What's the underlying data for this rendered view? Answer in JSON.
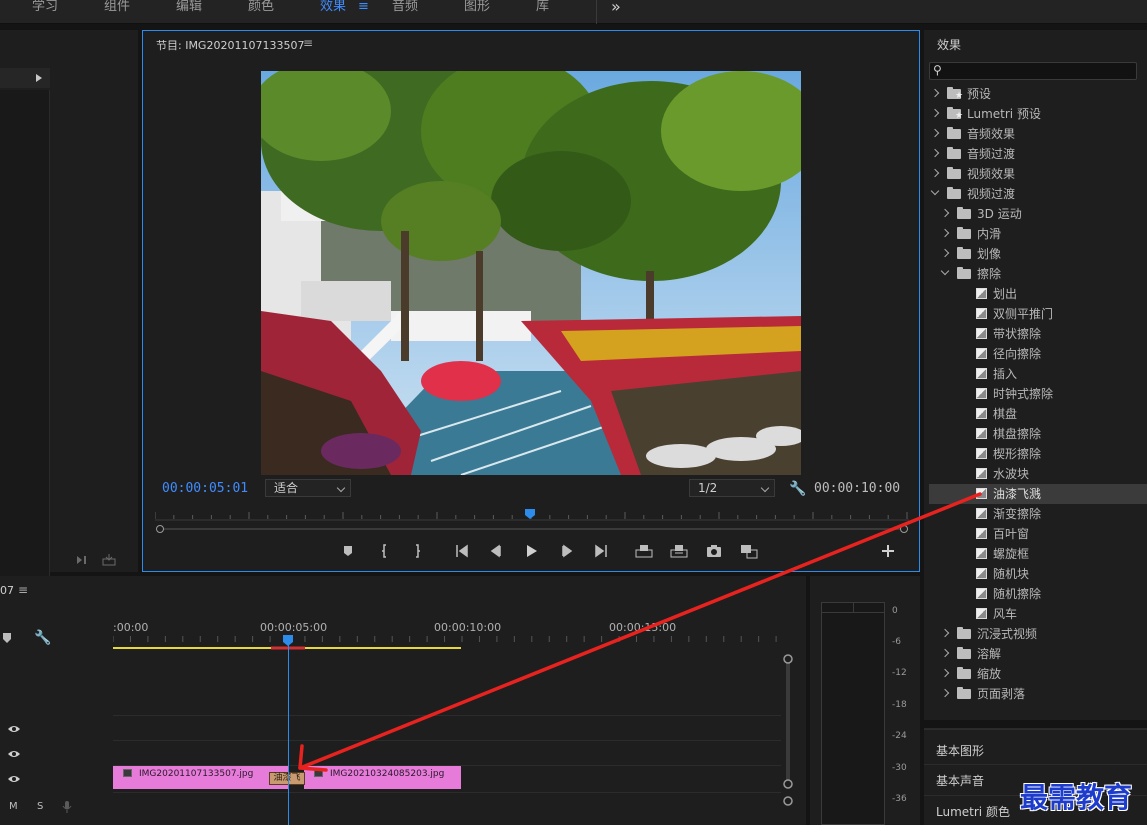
{
  "workspace": {
    "tabs": [
      {
        "label": "学习",
        "active": false
      },
      {
        "label": "组件",
        "active": false
      },
      {
        "label": "编辑",
        "active": false
      },
      {
        "label": "颜色",
        "active": false
      },
      {
        "label": "效果",
        "active": true
      },
      {
        "label": "音频",
        "active": false
      },
      {
        "label": "图形",
        "active": false
      },
      {
        "label": "库",
        "active": false
      }
    ],
    "menu_glyph": "≡",
    "more_glyph": "»"
  },
  "program": {
    "title": "节目: IMG20201107133507",
    "menu_glyph": "≡",
    "timecode_current": "00:00:05:01",
    "timecode_duration": "00:00:10:00",
    "fit_select": "适合",
    "resolution_select": "1/2",
    "accent_color": "#2d8ceb"
  },
  "effects": {
    "title": "效果",
    "search_placeholder": "",
    "tree": [
      {
        "label": "预设",
        "level": 0,
        "type": "preset-folder",
        "expanded": false
      },
      {
        "label": "Lumetri 预设",
        "level": 0,
        "type": "preset-folder",
        "expanded": false
      },
      {
        "label": "音频效果",
        "level": 0,
        "type": "folder",
        "expanded": false
      },
      {
        "label": "音频过渡",
        "level": 0,
        "type": "folder",
        "expanded": false
      },
      {
        "label": "视频效果",
        "level": 0,
        "type": "folder",
        "expanded": false
      },
      {
        "label": "视频过渡",
        "level": 0,
        "type": "folder",
        "expanded": true
      },
      {
        "label": "3D 运动",
        "level": 1,
        "type": "folder",
        "expanded": false
      },
      {
        "label": "内滑",
        "level": 1,
        "type": "folder",
        "expanded": false
      },
      {
        "label": "划像",
        "level": 1,
        "type": "folder",
        "expanded": false
      },
      {
        "label": "擦除",
        "level": 1,
        "type": "folder",
        "expanded": true
      },
      {
        "label": "划出",
        "level": 2,
        "type": "effect"
      },
      {
        "label": "双侧平推门",
        "level": 2,
        "type": "effect"
      },
      {
        "label": "带状擦除",
        "level": 2,
        "type": "effect"
      },
      {
        "label": "径向擦除",
        "level": 2,
        "type": "effect"
      },
      {
        "label": "插入",
        "level": 2,
        "type": "effect"
      },
      {
        "label": "时钟式擦除",
        "level": 2,
        "type": "effect"
      },
      {
        "label": "棋盘",
        "level": 2,
        "type": "effect"
      },
      {
        "label": "棋盘擦除",
        "level": 2,
        "type": "effect"
      },
      {
        "label": "楔形擦除",
        "level": 2,
        "type": "effect"
      },
      {
        "label": "水波块",
        "level": 2,
        "type": "effect"
      },
      {
        "label": "油漆飞溅",
        "level": 2,
        "type": "effect",
        "selected": true
      },
      {
        "label": "渐变擦除",
        "level": 2,
        "type": "effect"
      },
      {
        "label": "百叶窗",
        "level": 2,
        "type": "effect"
      },
      {
        "label": "螺旋框",
        "level": 2,
        "type": "effect"
      },
      {
        "label": "随机块",
        "level": 2,
        "type": "effect"
      },
      {
        "label": "随机擦除",
        "level": 2,
        "type": "effect"
      },
      {
        "label": "风车",
        "level": 2,
        "type": "effect"
      },
      {
        "label": "沉浸式视频",
        "level": 1,
        "type": "folder",
        "expanded": false
      },
      {
        "label": "溶解",
        "level": 1,
        "type": "folder",
        "expanded": false
      },
      {
        "label": "缩放",
        "level": 1,
        "type": "folder",
        "expanded": false
      },
      {
        "label": "页面剥落",
        "level": 1,
        "type": "folder",
        "expanded": false
      }
    ],
    "sections": [
      "基本图形",
      "基本声音",
      "Lumetri 颜色"
    ]
  },
  "timeline": {
    "title": "07",
    "menu_glyph": "≡",
    "ruler_labels": [
      ":00:00",
      "00:00:05:00",
      "00:00:10:00",
      "00:00:15:00"
    ],
    "track_controls": {
      "mute": "M",
      "solo": "S"
    },
    "clips": [
      {
        "name": "IMG20201107133507.jpg",
        "color": "#e67bd9"
      },
      {
        "name": "IMG20210324085203.jpg",
        "color": "#e67bd9"
      }
    ],
    "transition_label": "油漆飞"
  },
  "meter": {
    "db_labels": [
      "0",
      "-6",
      "-12",
      "-18",
      "-24",
      "-30",
      "-36"
    ]
  },
  "watermark": "最需教育",
  "annotation_color": "#e8231f"
}
